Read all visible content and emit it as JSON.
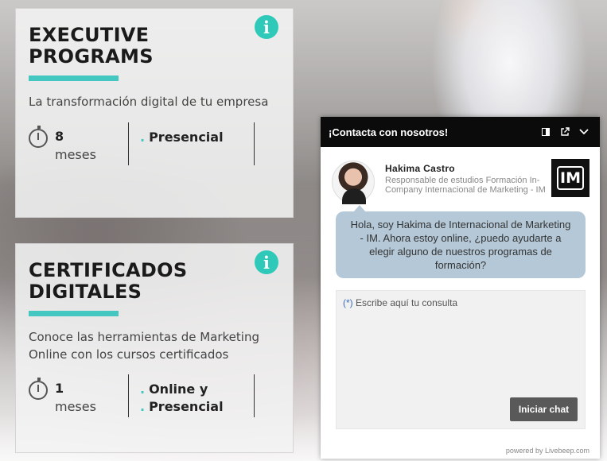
{
  "cards": [
    {
      "title_lines": [
        "EXECUTIVE",
        "PROGRAMS"
      ],
      "description": "La transformación digital de tu empresa",
      "duration_value": "8",
      "duration_unit": "meses",
      "modes": [
        "Presencial"
      ],
      "info_icon": "i"
    },
    {
      "title_lines": [
        "CERTIFICADOS",
        "DIGITALES"
      ],
      "description": "Conoce las herramientas de Marketing Online con los cursos certificados",
      "duration_value": "1",
      "duration_unit": "meses",
      "modes": [
        "Online y",
        "Presencial"
      ],
      "info_icon": "i"
    }
  ],
  "chat": {
    "header_title": "¡Contacta con nosotros!",
    "header_icons": [
      "panel-icon",
      "popout-icon",
      "chevron-down-icon"
    ],
    "agent": {
      "name": "Hakima Castro",
      "role": "Responsable de estudios Formación In-Company Internacional de Marketing - IM",
      "logo_text": "IM"
    },
    "message": "Hola, soy Hakima de Internacional de Marketing - IM. Ahora estoy online, ¿puedo ayudarte a elegir alguno de nuestros programas de formación?",
    "input": {
      "required_marker": "(*)",
      "placeholder": "Escribe aquí tu consulta"
    },
    "start_button": "Iniciar chat",
    "powered_by": "powered by Livebeep.com"
  },
  "colors": {
    "accent": "#43c7c0",
    "info_icon": "#2fc9b9",
    "chat_header": "#0b0b0b",
    "bubble": "#b4c8d7",
    "button": "#595959"
  }
}
